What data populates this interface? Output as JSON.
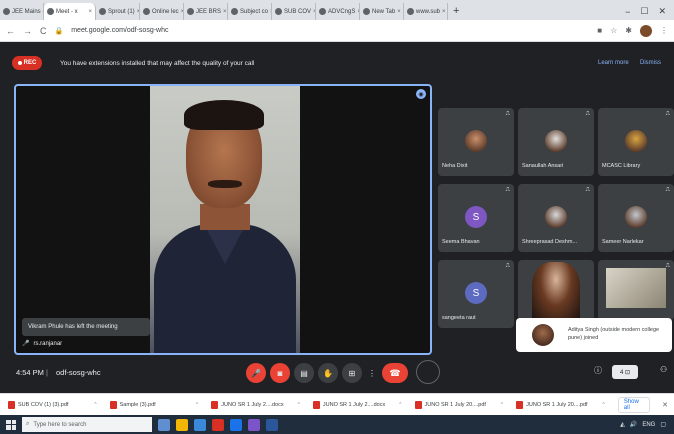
{
  "browser": {
    "tabs": [
      {
        "label": "JEE Mains - x",
        "active": false
      },
      {
        "label": "Meet - x",
        "active": true
      },
      {
        "label": "Sprout (1)",
        "active": false
      },
      {
        "label": "Online lec",
        "active": false
      },
      {
        "label": "JEE BRS",
        "active": false
      },
      {
        "label": "Subject co",
        "active": false
      },
      {
        "label": "SUB COV",
        "active": false
      },
      {
        "label": "ADVCngS",
        "active": false
      },
      {
        "label": "New Tab",
        "active": false
      },
      {
        "label": "www.sub",
        "active": false
      }
    ],
    "new_tab": "+",
    "url": "meet.google.com/odf-sosg-whc",
    "minimize": "−",
    "maximize": "☐",
    "close": "✕"
  },
  "banner": {
    "rec_label": "REC",
    "message": "You have extensions installed that may affect the quality of your call",
    "learn_more": "Learn more",
    "dismiss": "Dismiss"
  },
  "main_video": {
    "toast": "Vikram Phule has left the meeting",
    "name": "rs.ranjanar"
  },
  "participants": [
    {
      "name": "Neha Dixit",
      "type": "photo",
      "color": "#c98f6b"
    },
    {
      "name": "Sanaullah Ansari",
      "type": "photo",
      "color": "#e3e0db"
    },
    {
      "name": "MCASC Library",
      "type": "photo",
      "color": "#d9a441"
    },
    {
      "name": "Seema Bhavan",
      "type": "letter",
      "letter": "S",
      "color": "#7e57c2"
    },
    {
      "name": "Shreeprasad Deshm...",
      "type": "photo",
      "color": "#d8d8d8"
    },
    {
      "name": "Sameer Narlekar",
      "type": "photo",
      "color": "#c4c7cc"
    },
    {
      "name": "sangeeta raut",
      "type": "letter",
      "letter": "S",
      "color": "#5c6bc0"
    }
  ],
  "join_toast": {
    "text": "Aditya Singh (outside modern college pune) joined"
  },
  "bottom_bar": {
    "time": "4:54 PM",
    "separator": "|",
    "meeting_code": "odf-sosg-whc",
    "chat_badge": "4 ⊡"
  },
  "downloads": {
    "items": [
      "SUB COV (1) (3).pdf",
      "Sample (3).pdf",
      "JUNO SR 1 July 2....docx",
      "JUNO SR 1 July 2....docx",
      "JUNO SR 1 July 20....pdf",
      "JUNO SR 1 July 20....pdf"
    ],
    "show_all": "Show all",
    "close": "✕"
  },
  "taskbar": {
    "search_placeholder": "Type here to search",
    "tray_text": "ENG"
  },
  "colors": {
    "accent": "#8ab4f8",
    "danger": "#ea4335",
    "surface": "#202124",
    "tile": "#3c4043"
  }
}
